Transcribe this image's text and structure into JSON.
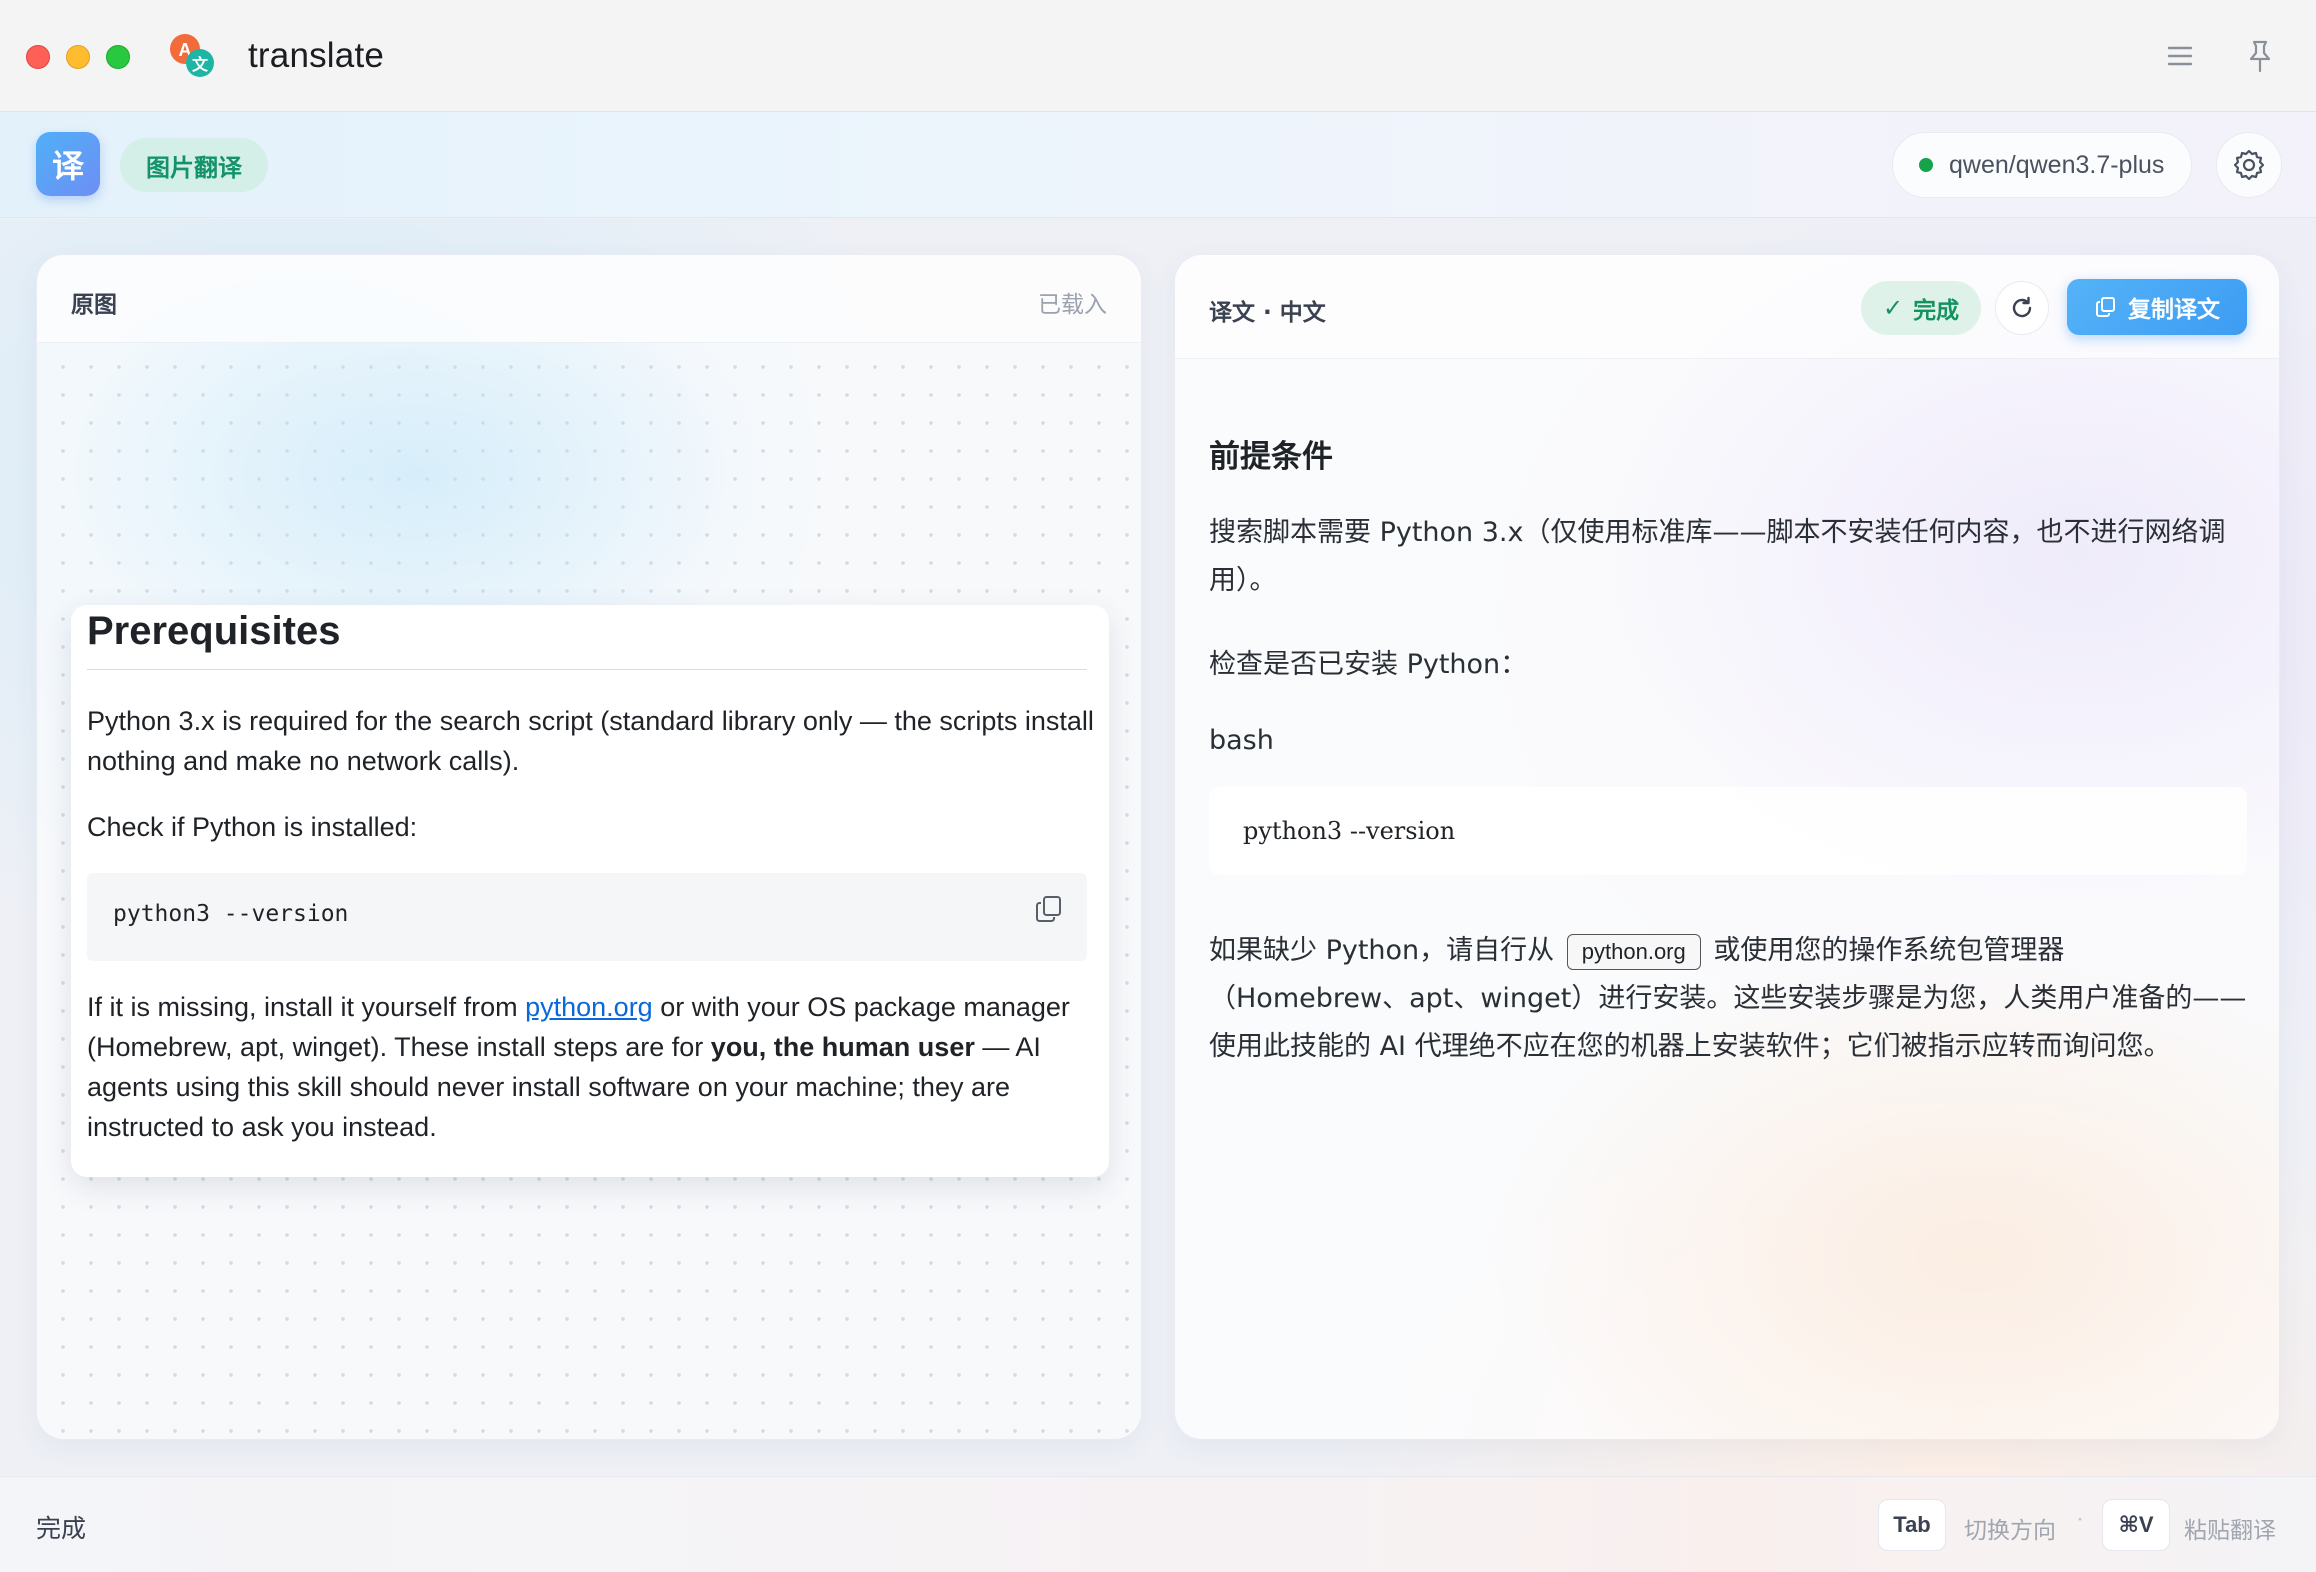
{
  "window": {
    "title": "translate"
  },
  "toolbar": {
    "app_badge": "译",
    "mode_label": "图片翻译",
    "model": "qwen/qwen3.7-plus",
    "model_status_color": "#16a34a"
  },
  "source_panel": {
    "label": "原图",
    "status": "已载入",
    "image": {
      "heading": "Prerequisites",
      "paragraph1": "Python 3.x is required for the search script (standard library only — the scripts install nothing and make no network calls).",
      "paragraph2": "Check if Python is installed:",
      "code": "python3 --version",
      "paragraph3_prefix": "If it is missing, install it yourself from ",
      "paragraph3_link": "python.org",
      "paragraph3_mid": " or with your OS package manager (Homebrew, apt, winget). These install steps are for ",
      "paragraph3_bold": "you, the human user",
      "paragraph3_suffix": " — AI agents using this skill should never install software on your machine; they are instructed to ask you instead."
    }
  },
  "translation_panel": {
    "label": "译文 · 中文",
    "status": "完成",
    "copy_button": "复制译文",
    "heading": "前提条件",
    "paragraph1": "搜索脚本需要 Python 3.x（仅使用标准库——脚本不安装任何内容，也不进行网络调用）。",
    "paragraph2": "检查是否已安装 Python：",
    "code_lang": "bash",
    "code": "python3 --version",
    "paragraph4_prefix": "如果缺少 Python，请自行从",
    "paragraph4_code": "python.org",
    "paragraph4_suffix": "或使用您的操作系统包管理器（Homebrew、apt、winget）进行安装。这些安装步骤是为您，人类用户准备的——使用此技能的 AI 代理绝不应在您的机器上安装软件；它们被指示应转而询问您。"
  },
  "statusbar": {
    "status": "完成",
    "shortcut1_key": "Tab",
    "shortcut1_label": "切换方向",
    "separator": "·",
    "shortcut2_key": "⌘V",
    "shortcut2_label": "粘贴翻译"
  },
  "colors": {
    "accent": "#3d9cf3",
    "success": "#15935f",
    "link": "#0969da"
  }
}
